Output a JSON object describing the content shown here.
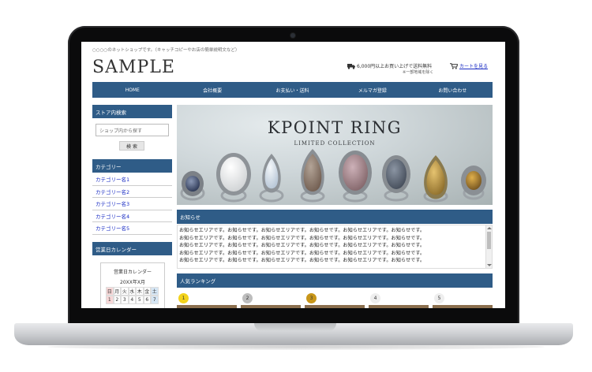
{
  "site": {
    "tagline": "○○○○のネットショップです。（キャッチコピーやお店の簡単説明文など）",
    "logo": "SAMPLE",
    "shipping_text": "6,000円以上お買い上げで送料無料",
    "shipping_note": "※一部地域を除く",
    "cart_link": "カートを見る"
  },
  "nav": {
    "items": [
      {
        "label": "HOME"
      },
      {
        "label": "会社概要"
      },
      {
        "label": "お支払い・送料"
      },
      {
        "label": "メルマガ登録"
      },
      {
        "label": "お問い合わせ"
      }
    ]
  },
  "sidebar": {
    "search_heading": "ストア内検索",
    "search_placeholder": "ショップ内から探す",
    "search_button": "検 索",
    "category_heading": "カテゴリー",
    "categories": [
      {
        "label": "カテゴリー名1"
      },
      {
        "label": "カテゴリー名2"
      },
      {
        "label": "カテゴリー名3"
      },
      {
        "label": "カテゴリー名4"
      },
      {
        "label": "カテゴリー名5"
      }
    ],
    "calendar_heading": "営業日カレンダー",
    "calendar": {
      "title": "営業日カレンダー",
      "month": "20XX年X月",
      "weekdays": [
        "日",
        "月",
        "火",
        "水",
        "木",
        "金",
        "土"
      ],
      "days": [
        "1",
        "2",
        "3",
        "4",
        "5",
        "6",
        "7"
      ]
    }
  },
  "hero": {
    "title": "KPOINT RING",
    "subtitle": "LIMITED COLLECTION"
  },
  "news": {
    "heading": "お知らせ",
    "lines": [
      "お知らせエリアです。お知らせです。お知らせエリアです。お知らせです。お知らせエリアです。お知らせです。",
      "お知らせエリアです。お知らせです。お知らせエリアです。お知らせです。お知らせエリアです。お知らせです。",
      "お知らせエリアです。お知らせです。お知らせエリアです。お知らせです。お知らせエリアです。お知らせです。",
      "お知らせエリアです。お知らせです。お知らせエリアです。お知らせです。お知らせエリアです。お知らせです。",
      "お知らせエリアです。お知らせです。お知らせエリアです。お知らせです。お知らせエリアです。お知らせです。"
    ]
  },
  "ranking": {
    "heading": "人気ランキング",
    "items": [
      {
        "rank": "1",
        "color": "#f2d21b"
      },
      {
        "rank": "2",
        "color": "#bdbdbd"
      },
      {
        "rank": "3",
        "color": "#c8961a"
      },
      {
        "rank": "4",
        "color": "#eeeeee"
      },
      {
        "rank": "5",
        "color": "#eeeeee"
      }
    ]
  },
  "colors": {
    "accent": "#2f5c87",
    "link": "#1a2cc4"
  }
}
